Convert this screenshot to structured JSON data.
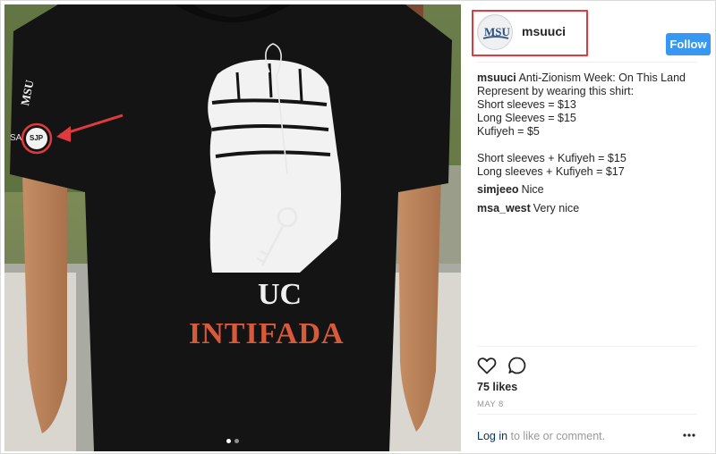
{
  "post": {
    "username": "msuuci",
    "follow_label": "Follow",
    "avatar_text": "MSU",
    "caption": {
      "username": "msuuci",
      "lines": [
        "Anti-Zionism Week: On This Land",
        "Represent by wearing this shirt:",
        "Short sleeves = $13",
        "Long Sleeves = $15",
        "Kufiyeh = $5",
        "",
        "Short sleeves + Kufiyeh = $15",
        "Long sleeves + Kufiyeh = $17"
      ]
    },
    "comments": [
      {
        "username": "simjeeo",
        "text": "Nice"
      },
      {
        "username": "msa_west",
        "text": "Very nice"
      }
    ],
    "likes": "75 likes",
    "date": "MAY 8",
    "login_link": "Log in",
    "login_suffix": " to like or comment.",
    "carousel": {
      "count": 2,
      "active": 0
    }
  },
  "shirt": {
    "text_uc": "UC",
    "text_intifada": "INTIFADA",
    "sleeve_logo": "MSU",
    "sleeve_patch": "SJP",
    "sleeve_text": "SA"
  },
  "annotations": {
    "highlight_color": "#e03a3e",
    "arrow_color": "#e03a3e"
  },
  "colors": {
    "follow": "#3897f0",
    "link": "#003569",
    "muted": "#999999"
  },
  "icons": [
    "heart-icon",
    "comment-icon",
    "more-options-icon",
    "key-icon"
  ]
}
